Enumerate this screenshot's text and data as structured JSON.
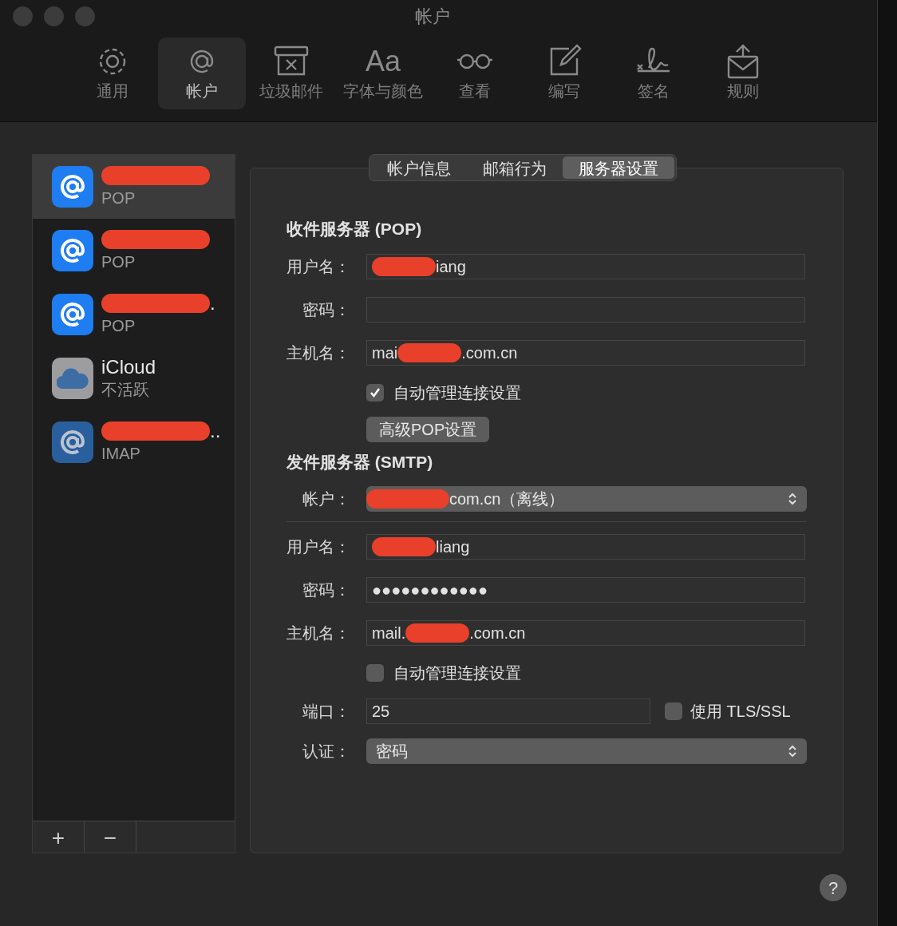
{
  "window": {
    "title": "帐户"
  },
  "toolbar": [
    {
      "label": "通用",
      "selected": false
    },
    {
      "label": "帐户",
      "selected": true
    },
    {
      "label": "垃圾邮件",
      "selected": false
    },
    {
      "label": "字体与颜色",
      "glyph": "Aa",
      "selected": false
    },
    {
      "label": "查看",
      "selected": false
    },
    {
      "label": "编写",
      "selected": false
    },
    {
      "label": "签名",
      "selected": false
    },
    {
      "label": "规则",
      "selected": false
    }
  ],
  "accounts": [
    {
      "kind": "mail",
      "name_redacted": true,
      "type": "POP",
      "selected": true
    },
    {
      "kind": "mail",
      "name_redacted": true,
      "type": "POP",
      "selected": false
    },
    {
      "kind": "mail",
      "name_redacted": true,
      "name_tail": ".",
      "type": "POP",
      "selected": false
    },
    {
      "kind": "cloud",
      "name": "iCloud",
      "type": "不活跃",
      "selected": false
    },
    {
      "kind": "mail-dim",
      "name_redacted": true,
      "name_tail": "..",
      "type": "IMAP",
      "selected": false
    }
  ],
  "account_buttons": [
    "+",
    "−"
  ],
  "tabs": [
    {
      "label": "帐户信息",
      "selected": false
    },
    {
      "label": "邮箱行为",
      "selected": false
    },
    {
      "label": "服务器设置",
      "selected": true
    }
  ],
  "incoming": {
    "heading": "收件服务器 (POP)",
    "rows": [
      {
        "kind": "field",
        "label": "用户名：",
        "redacted": true,
        "value_after": "iang"
      },
      {
        "kind": "field",
        "label": "密码："
      },
      {
        "kind": "field",
        "label": "主机名：",
        "value_before": "mai",
        "redacted": true,
        "value_after": ".com.cn"
      },
      {
        "kind": "checkbox",
        "label": "自动管理连接设置",
        "checked": true
      },
      {
        "kind": "button",
        "label": "高级POP设置"
      }
    ]
  },
  "outgoing": {
    "heading": "发件服务器 (SMTP)",
    "account": {
      "label": "帐户：",
      "redacted": true,
      "value_after": "com.cn（离线）"
    },
    "rows": [
      {
        "kind": "field",
        "label": "用户名：",
        "redacted": true,
        "value_after": "liang"
      },
      {
        "kind": "field",
        "label": "密码：",
        "value_before": "●●●●●●●●●●●●"
      },
      {
        "kind": "field",
        "label": "主机名：",
        "value_before": "mail.",
        "redacted": true,
        "value_after": ".com.cn"
      },
      {
        "kind": "checkbox",
        "label": "自动管理连接设置",
        "checked": false
      },
      {
        "kind": "port",
        "label": "端口：",
        "value_before": "25",
        "tls": {
          "label": "使用 TLS/SSL",
          "checked": false
        }
      },
      {
        "kind": "select",
        "label": "认证：",
        "value_before": "密码"
      }
    ]
  },
  "help": {
    "glyph": "?"
  }
}
